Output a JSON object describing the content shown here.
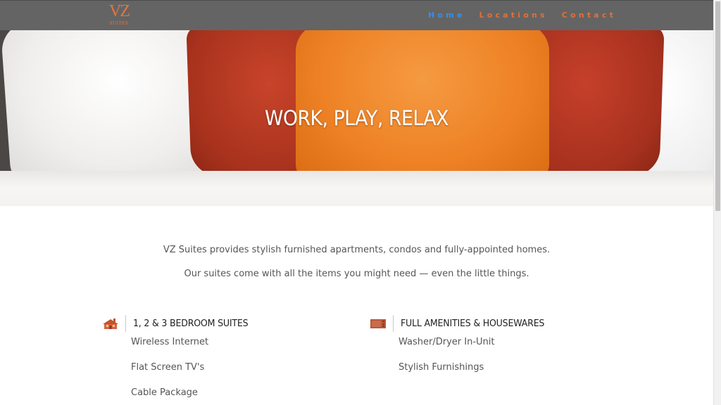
{
  "header": {
    "logo_mark": "VZ",
    "logo_sub": "SUITES",
    "nav": {
      "home": "Home",
      "locations": "Locations",
      "contact": "Contact"
    }
  },
  "hero": {
    "title": "WORK, PLAY, RELAX"
  },
  "intro": {
    "line1": "VZ Suites provides stylish furnished apartments, condos and fully-appointed homes.",
    "line2": "Our suites come with all the items you might need — even the little things."
  },
  "features": {
    "left": {
      "icon": "house-icon",
      "heading": "1, 2 & 3 BEDROOM SUITES",
      "items": [
        "Wireless Internet",
        "Flat Screen TV's",
        "Cable Package"
      ]
    },
    "right": {
      "icon": "appliance-icon",
      "heading": "FULL AMENITIES & HOUSEWARES",
      "items": [
        "Washer/Dryer In-Unit",
        "Stylish Furnishings"
      ]
    }
  },
  "colors": {
    "header_bg": "#646464",
    "accent_orange": "#e0703a",
    "nav_active_blue": "#3b8de6"
  }
}
